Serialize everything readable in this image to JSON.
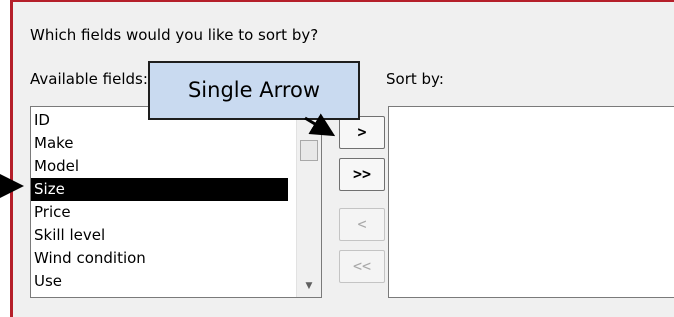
{
  "dialog": {
    "question": "Which fields would you like to sort by?",
    "available_label": "Available fields:",
    "sortby_label": "Sort by:",
    "available_fields": [
      "ID",
      "Make",
      "Model",
      "Size",
      "Price",
      "Skill level",
      "Wind condition",
      "Use"
    ],
    "selected_field": "Size",
    "sort_fields": [],
    "buttons": {
      "add_one": ">",
      "add_all": ">>",
      "remove_one": "<",
      "remove_all": "<<"
    }
  },
  "annotation": {
    "callout_text": "Single Arrow",
    "callout_color": "#c9daf0"
  },
  "colors": {
    "selection": "#000000",
    "dialog_border": "#b51f2a"
  }
}
